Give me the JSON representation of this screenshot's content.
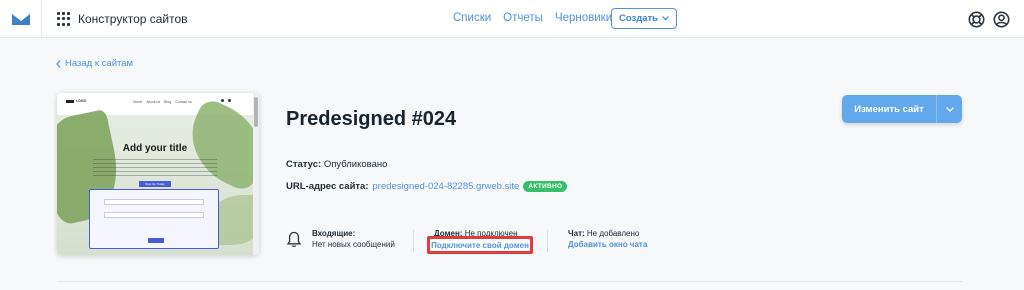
{
  "topbar": {
    "app_title": "Конструктор сайтов",
    "nav": [
      "Списки",
      "Отчеты",
      "Черновики"
    ],
    "create_label": "Создать"
  },
  "back_link": "Назад к сайтам",
  "preview": {
    "logo_text": "LOGO",
    "links": [
      "Home",
      "About us",
      "Blog",
      "Contact us"
    ],
    "hero_title": "Add your title",
    "hero_button": "Sign Up Today",
    "submit": "Sign up"
  },
  "site": {
    "title": "Predesigned #024",
    "status_label": "Статус:",
    "status_value": "Опубликовано",
    "url_label": "URL-адрес сайта:",
    "url": "predesigned-024-82285.grweb.site",
    "badge": "АКТИВНО"
  },
  "info": {
    "inbox_label": "Входящие:",
    "inbox_value": "Нет новых сообщений",
    "domain_label": "Домен:",
    "domain_value": "Не подключен",
    "domain_link": "Подключите свой домен",
    "chat_label": "Чат:",
    "chat_value": "Не добавлено",
    "chat_link": "Добавить окно чата"
  },
  "edit_button": "Изменить сайт",
  "colors": {
    "accent": "#4f93d8",
    "edit_button": "#62a8ec",
    "badge": "#37c06a",
    "highlight": "#e03c3c"
  },
  "icons": [
    "mail-logo-icon",
    "apps-grid-icon",
    "chevron-down-icon",
    "help-lifebuoy-icon",
    "account-icon",
    "chevron-left-icon",
    "bell-icon"
  ]
}
